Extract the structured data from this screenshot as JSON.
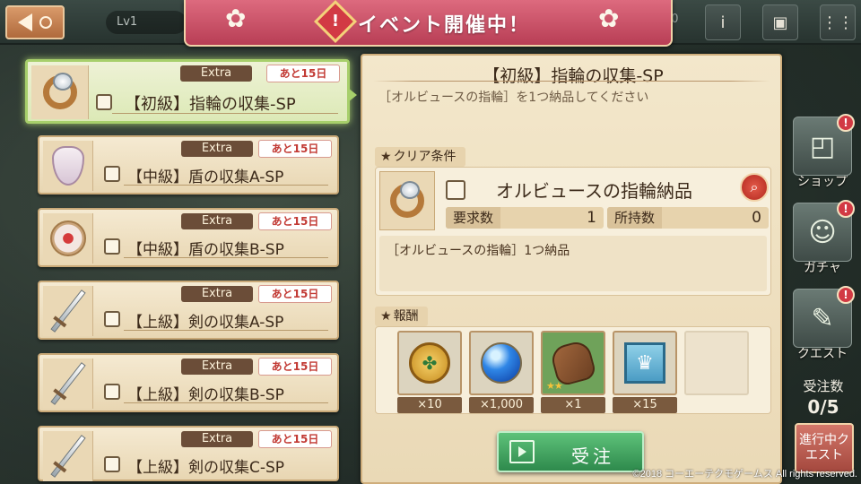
{
  "topbar": {
    "level_label": "Lv1",
    "count_text": "00",
    "icons": [
      "info-icon",
      "gift-icon",
      "menu-icon"
    ]
  },
  "banner": {
    "badge": "!",
    "title": "イベント開催中！"
  },
  "quests": [
    {
      "tag": "Extra",
      "days": "あと15日",
      "name": "【初級】指輪の収集-SP",
      "item_icon": "ring-icon",
      "active": true
    },
    {
      "tag": "Extra",
      "days": "あと15日",
      "name": "【中級】盾の収集A-SP",
      "item_icon": "shield-icon",
      "active": false
    },
    {
      "tag": "Extra",
      "days": "あと15日",
      "name": "【中級】盾の収集B-SP",
      "item_icon": "round-shield-icon",
      "active": false
    },
    {
      "tag": "Extra",
      "days": "あと15日",
      "name": "【上級】剣の収集A-SP",
      "item_icon": "sword-icon",
      "active": false
    },
    {
      "tag": "Extra",
      "days": "あと15日",
      "name": "【上級】剣の収集B-SP",
      "item_icon": "sword-icon",
      "active": false
    },
    {
      "tag": "Extra",
      "days": "あと15日",
      "name": "【上級】剣の収集C-SP",
      "item_icon": "sword-icon",
      "active": false
    }
  ],
  "detail": {
    "title": "【初級】指輪の収集-SP",
    "subtitle": "［オルビュースの指輪］を1つ納品してください",
    "clear_label": "クリア条件",
    "condition": {
      "name": "オルビュースの指輪納品",
      "required_label": "要求数",
      "required_value": "1",
      "owned_label": "所持数",
      "owned_value": "0",
      "description": "［オルビュースの指輪］1つ納品"
    },
    "reward_label": "報酬",
    "rewards": [
      {
        "icon": "coin-icon",
        "count": "×10"
      },
      {
        "icon": "blue-orb-icon",
        "count": "×1,000"
      },
      {
        "icon": "glove-icon",
        "count": "×1",
        "stars": "★★"
      },
      {
        "icon": "crown-icon",
        "count": "×15"
      }
    ],
    "accept_label": "受注"
  },
  "sidebar": {
    "shop_label": "ショップ",
    "gacha_label": "ガチャ",
    "quest_label": "クエスト",
    "badge": "!",
    "accept_count_label": "受注数",
    "accept_count": "0/5",
    "in_progress_label": "進行中クエスト"
  },
  "copyright": "©2018 コーエーテクモゲームス All rights reserved."
}
